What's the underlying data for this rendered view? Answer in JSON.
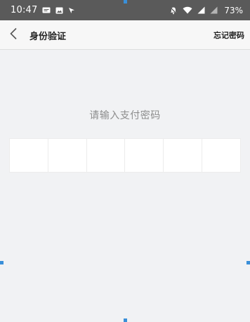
{
  "status_bar": {
    "time": "10:47",
    "battery": "73%",
    "left_icons": [
      "message-icon",
      "image-icon",
      "location-arrow-icon"
    ],
    "right_icons": [
      "mute-bell-icon",
      "wifi-icon",
      "signal-icon",
      "signal-icon"
    ],
    "background": "#5a5a5a"
  },
  "header": {
    "back_icon": "chevron-left-icon",
    "title": "身份验证",
    "forgot_label": "忘记密码"
  },
  "main": {
    "prompt": "请输入支付密码",
    "digit_count": 6
  }
}
